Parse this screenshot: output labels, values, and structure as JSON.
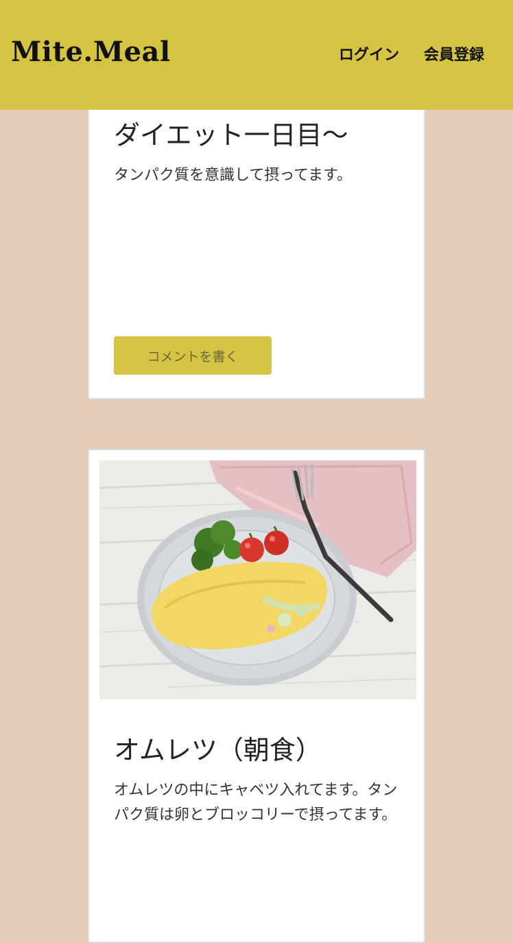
{
  "header": {
    "logo": "Mite.Meal",
    "nav": {
      "login": "ログイン",
      "register": "会員登録"
    }
  },
  "posts": [
    {
      "title": "ダイエット一日目〜",
      "body": "タンパク質を意識して摂ってます。",
      "comment_button": "コメントを書く"
    },
    {
      "title": "オムレツ（朝食）",
      "body": "オムレツの中にキャベツ入れてます。タンパク質は卵とブロッコリーで摂ってます。"
    }
  ],
  "colors": {
    "header_bg": "#d4c442",
    "page_bg": "#e6ccb6",
    "card_bg": "#ffffff",
    "button_bg": "#d4c442"
  }
}
